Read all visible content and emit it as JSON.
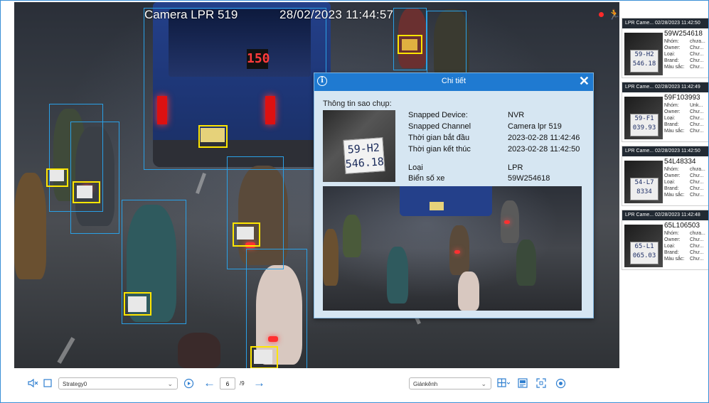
{
  "osd": {
    "camera_name": "Camera LPR 519",
    "timestamp": "28/02/2023  11:44:57"
  },
  "dialog": {
    "title": "Chi tiết",
    "section_title": "Thông tin sao chụp:",
    "thumb_plate_line1": "59-H2",
    "thumb_plate_line2": "546.18",
    "fields": [
      {
        "label": "Snapped Device:",
        "value": "NVR"
      },
      {
        "label": "Snapped Channel",
        "value": "Camera lpr 519"
      },
      {
        "label": "Thời gian bắt đầu",
        "value": "2023-02-28 11:42:46"
      },
      {
        "label": "Thời gian kết thúc",
        "value": "2023-02-28 11:42:50"
      },
      {
        "label": "Loại",
        "value": "LPR"
      },
      {
        "label": "Biển số xe",
        "value": "59W254618"
      }
    ]
  },
  "captures": [
    {
      "header": "LPR Came...  02/28/2023 11:42:50",
      "plate": "59W254618",
      "thumb_l1": "59-H2",
      "thumb_l2": "546.18",
      "rows": [
        {
          "k": "Nhóm:",
          "v": "chưa..."
        },
        {
          "k": "Owner:",
          "v": "Chư..."
        },
        {
          "k": "Loại:",
          "v": "Chư..."
        },
        {
          "k": "Brand:",
          "v": "Chư..."
        },
        {
          "k": "Màu sắc:",
          "v": "Chư..."
        }
      ]
    },
    {
      "header": "LPR Came...  02/28/2023 11:42:49",
      "plate": "59F103993",
      "thumb_l1": "59-F1",
      "thumb_l2": "039.93",
      "rows": [
        {
          "k": "Nhóm:",
          "v": "Unk..."
        },
        {
          "k": "Owner:",
          "v": "Chư..."
        },
        {
          "k": "Loại:",
          "v": "Chư..."
        },
        {
          "k": "Brand:",
          "v": "Chư..."
        },
        {
          "k": "Màu sắc:",
          "v": "Chư..."
        }
      ]
    },
    {
      "header": "LPR Came...  02/28/2023 11:42:50",
      "plate": "54L48334",
      "thumb_l1": "54-L7",
      "thumb_l2": "8334",
      "rows": [
        {
          "k": "Nhóm:",
          "v": "chưa..."
        },
        {
          "k": "Owner:",
          "v": "Chư..."
        },
        {
          "k": "Loại:",
          "v": "Chư..."
        },
        {
          "k": "Brand:",
          "v": "Chư..."
        },
        {
          "k": "Màu sắc:",
          "v": "Chư..."
        }
      ]
    },
    {
      "header": "LPR Came...  02/28/2023 11:42:48",
      "plate": "65L106503",
      "thumb_l1": "65-L1",
      "thumb_l2": "065.03",
      "rows": [
        {
          "k": "Nhóm:",
          "v": "chưa..."
        },
        {
          "k": "Owner:",
          "v": "Chư..."
        },
        {
          "k": "Loại:",
          "v": "Chư..."
        },
        {
          "k": "Brand:",
          "v": "Chư..."
        },
        {
          "k": "Màu sắc:",
          "v": "Chư..."
        }
      ]
    }
  ],
  "toolbar": {
    "strategy_value": "Strategy0",
    "page_current": "6",
    "page_total": "/9",
    "layout_value": "Giánkênh"
  },
  "icons": {
    "mute": "speaker-mute-icon",
    "stop": "square-stop-icon",
    "playback": "playback-icon",
    "prev": "arrow-left-icon",
    "next": "arrow-right-icon",
    "grid": "grid-layout-icon",
    "fullscreen": "fullscreen-icon",
    "snapshot": "snapshot-icon"
  },
  "colors": {
    "accent": "#1f7ad1",
    "detection_box": "#2aa0e6",
    "plate_box": "#ffe600"
  }
}
